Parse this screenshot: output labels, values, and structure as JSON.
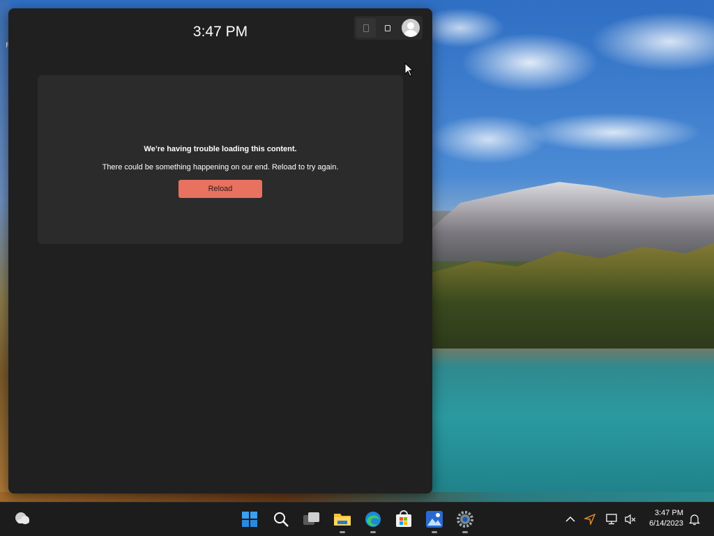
{
  "desktop": {
    "label_fragment": "F"
  },
  "widgets_window": {
    "header_time": "3:47 PM",
    "error_card": {
      "title": "We’re having trouble loading this content.",
      "message": "There could be something happening on our end. Reload to try again.",
      "reload_label": "Reload"
    },
    "toolbar_icons": [
      "widget-tab-icon",
      "widget-tab-icon",
      "user-avatar"
    ]
  },
  "taskbar": {
    "left_icon": "weather-cloud-icon",
    "pinned": [
      {
        "name": "start-button",
        "icon": "windows-logo-icon",
        "running": false
      },
      {
        "name": "search-button",
        "icon": "search-icon",
        "running": false
      },
      {
        "name": "task-view-button",
        "icon": "task-view-icon",
        "running": false
      },
      {
        "name": "file-explorer-button",
        "icon": "folder-icon",
        "running": true
      },
      {
        "name": "edge-button",
        "icon": "edge-icon",
        "running": true
      },
      {
        "name": "store-button",
        "icon": "store-icon",
        "running": false
      },
      {
        "name": "photos-button",
        "icon": "photos-icon",
        "running": true
      },
      {
        "name": "settings-button",
        "icon": "gear-icon",
        "running": true
      }
    ],
    "tray": {
      "icons": [
        "chevron-up-icon",
        "location-icon",
        "network-icon",
        "speaker-muted-icon",
        "notification-icon"
      ],
      "time": "3:47 PM",
      "date": "6/14/2023"
    }
  },
  "colors": {
    "window_bg": "#202020",
    "card_bg": "#2b2b2b",
    "reload_accent": "#e8715f",
    "taskbar_bg": "#1c1c1c"
  }
}
